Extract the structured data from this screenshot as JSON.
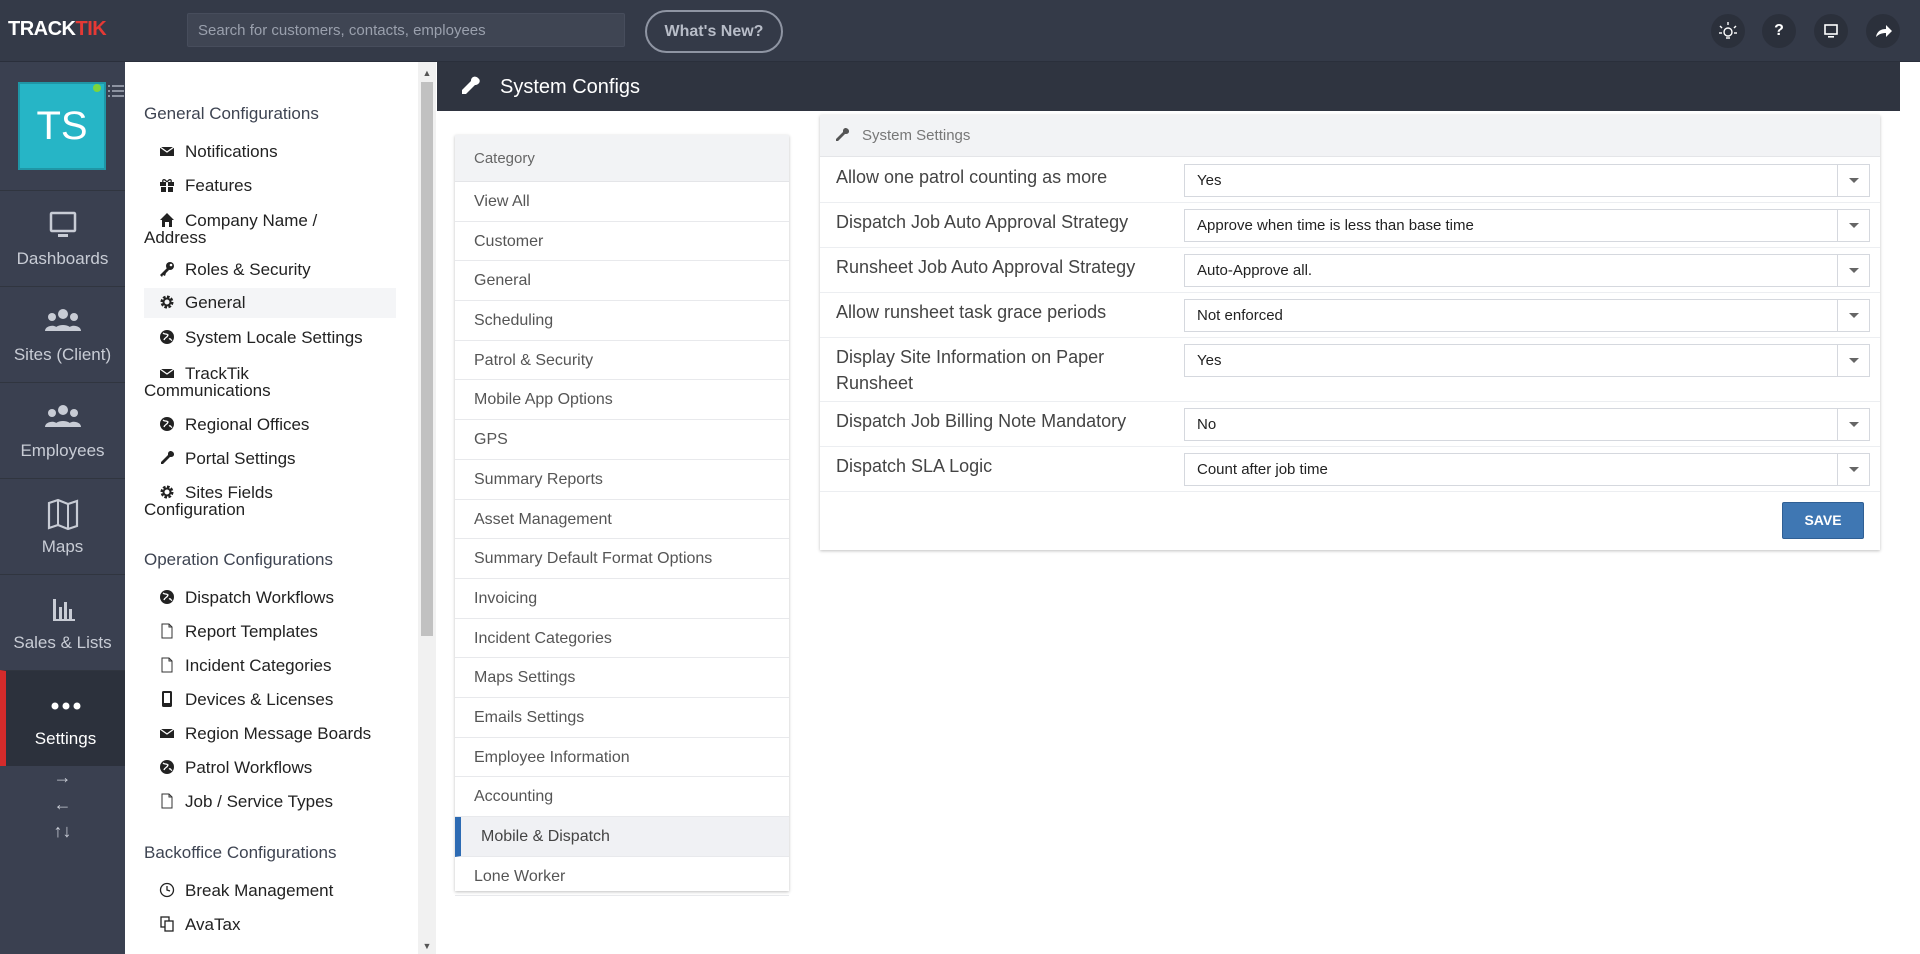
{
  "topbar": {
    "logo_track": "TRACK",
    "logo_tik": "TIK",
    "search_placeholder": "Search for customers, contacts, employees",
    "whats_new": "What's New?",
    "icons": [
      "lightbulb-icon",
      "help-icon",
      "monitor-icon",
      "share-icon"
    ],
    "help_glyph": "?"
  },
  "user": {
    "initials": "TS"
  },
  "leftnav": {
    "items": [
      {
        "label": "Dashboards",
        "icon": "monitor-icon"
      },
      {
        "label": "Sites (Client)",
        "icon": "group-icon"
      },
      {
        "label": "Employees",
        "icon": "group-icon"
      },
      {
        "label": "Maps",
        "icon": "map-icon"
      },
      {
        "label": "Sales & Lists",
        "icon": "bar-chart-icon"
      },
      {
        "label": "Settings",
        "icon": "more-dots-icon"
      }
    ],
    "arrows": [
      "→",
      "←",
      "↑↓"
    ]
  },
  "menu": {
    "general_title": "General Configurations",
    "general": [
      {
        "label": "Notifications",
        "icon": "envelope-icon"
      },
      {
        "label": "Features",
        "icon": "gift-icon"
      },
      {
        "label": "Company Name /",
        "label2": "Address",
        "icon": "home-icon"
      },
      {
        "label": "Roles & Security",
        "icon": "key-icon"
      },
      {
        "label": "General",
        "icon": "gear-icon"
      },
      {
        "label": "System Locale Settings",
        "icon": "globe-icon"
      },
      {
        "label": "TrackTik",
        "label2": "Communications",
        "icon": "envelope-icon"
      },
      {
        "label": "Regional Offices",
        "icon": "globe-icon"
      },
      {
        "label": "Portal Settings",
        "icon": "wrench-icon"
      },
      {
        "label": "Sites Fields",
        "label2": "Configuration",
        "icon": "gear-icon"
      }
    ],
    "operation_title": "Operation Configurations",
    "operation": [
      {
        "label": "Dispatch Workflows",
        "icon": "globe-icon"
      },
      {
        "label": "Report Templates",
        "icon": "file-icon"
      },
      {
        "label": "Incident Categories",
        "icon": "file-icon"
      },
      {
        "label": "Devices & Licenses",
        "icon": "mobile-icon"
      },
      {
        "label": "Region Message Boards",
        "icon": "envelope-icon"
      },
      {
        "label": "Patrol Workflows",
        "icon": "globe-icon"
      },
      {
        "label": "Job / Service Types",
        "icon": "file-icon"
      }
    ],
    "backoffice_title": "Backoffice Configurations",
    "backoffice": [
      {
        "label": "Break Management",
        "icon": "clock-icon"
      },
      {
        "label": "AvaTax",
        "icon": "copy-icon"
      }
    ]
  },
  "header": {
    "title": "System Configs"
  },
  "categories": {
    "title": "Category",
    "items": [
      "View All",
      "Customer",
      "General",
      "Scheduling",
      "Patrol & Security",
      "Mobile App Options",
      "GPS",
      "Summary Reports",
      "Asset Management",
      "Summary Default Format Options",
      "Invoicing",
      "Incident Categories",
      "Maps Settings",
      "Emails Settings",
      "Employee Information",
      "Accounting",
      "Mobile & Dispatch",
      "Lone Worker"
    ],
    "active": "Mobile & Dispatch"
  },
  "settings": {
    "title": "System Settings",
    "rows": [
      {
        "label": "Allow one patrol counting as more",
        "value": "Yes"
      },
      {
        "label": "Dispatch Job Auto Approval Strategy",
        "value": "Approve when time is less than base time"
      },
      {
        "label": "Runsheet Job Auto Approval Strategy",
        "value": "Auto-Approve all."
      },
      {
        "label": "Allow runsheet task grace periods",
        "value": "Not enforced"
      },
      {
        "label": "Display Site Information on Paper Runsheet",
        "value": "Yes"
      },
      {
        "label": "Dispatch Job Billing Note Mandatory",
        "value": "No"
      },
      {
        "label": "Dispatch SLA Logic",
        "value": "Count after job time"
      }
    ],
    "save_label": "SAVE"
  },
  "colors": {
    "topbar": "#343a48",
    "leftnav": "#3a4050",
    "accent_red": "#d52b2b",
    "avatar": "#26b5c6",
    "save_button": "#3f77b3",
    "active_category_bar": "#2d6bb3"
  }
}
